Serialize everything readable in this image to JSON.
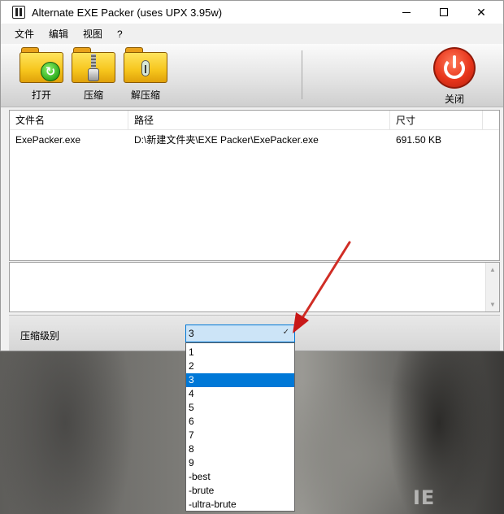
{
  "window": {
    "title": "Alternate EXE Packer (uses UPX 3.95w)"
  },
  "menu": {
    "items": [
      "文件",
      "编辑",
      "视图",
      "?"
    ]
  },
  "toolbar": {
    "open_label": "打开",
    "compress_label": "压缩",
    "decompress_label": "解压缩",
    "close_label": "关闭"
  },
  "file_list": {
    "columns": [
      "文件名",
      "路径",
      "尺寸"
    ],
    "rows": [
      {
        "name": "ExePacker.exe",
        "path": "D:\\新建文件夹\\EXE Packer\\ExePacker.exe",
        "size": "691.50 KB"
      }
    ]
  },
  "compression": {
    "label": "压缩级别",
    "selected": "3",
    "options": [
      "1",
      "2",
      "3",
      "4",
      "5",
      "6",
      "7",
      "8",
      "9",
      "-best",
      "-brute",
      "-ultra-brute"
    ],
    "highlighted_index": 2
  },
  "colors": {
    "selection": "#0078d7",
    "arrow": "#d42020"
  }
}
